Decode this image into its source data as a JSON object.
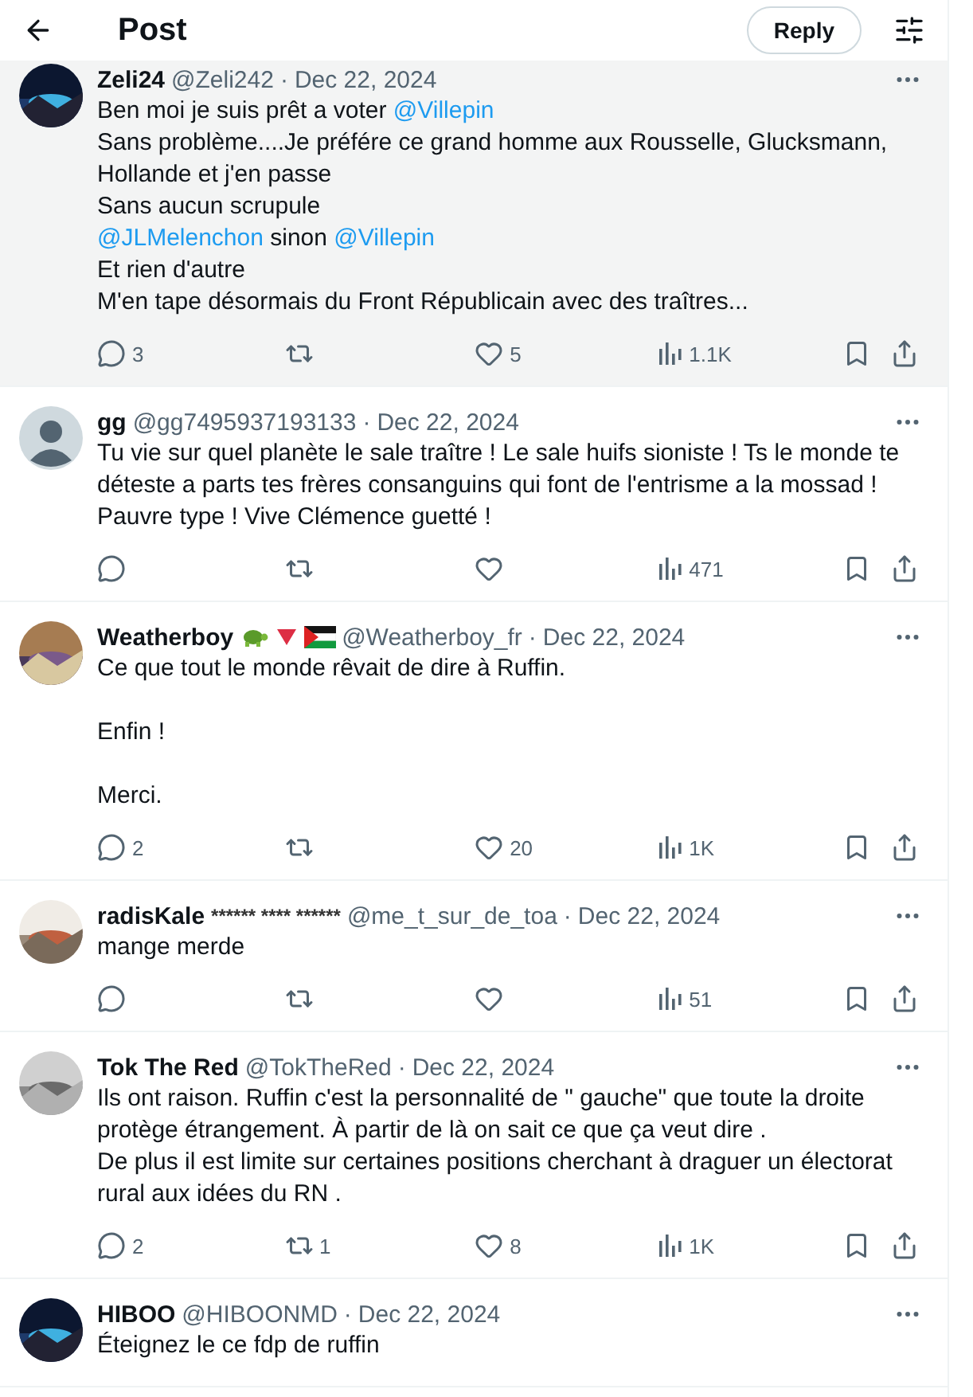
{
  "header": {
    "title": "Post",
    "reply_button": "Reply"
  },
  "replies": [
    {
      "name": "Zeli24",
      "handle": "@Zeli242",
      "date": "Dec 22, 2024",
      "separator": "·",
      "highlighted": true,
      "avatar": {
        "kind": "picture"
      },
      "paragraphs": [
        [
          [
            {
              "kind": "text",
              "text": "Ben moi je suis prêt a voter "
            },
            {
              "kind": "mention",
              "text": "@Villepin"
            }
          ],
          [
            {
              "kind": "text",
              "text": "Sans problème....Je préfére ce grand homme aux Rousselle, Glucksmann, Hollande et j'en passe"
            }
          ],
          [
            {
              "kind": "text",
              "text": "Sans aucun scrupule"
            }
          ],
          [
            {
              "kind": "mention",
              "text": "@JLMelenchon"
            },
            {
              "kind": "text",
              "text": " sinon "
            },
            {
              "kind": "mention",
              "text": "@Villepin"
            }
          ],
          [
            {
              "kind": "text",
              "text": "Et rien d'autre"
            }
          ],
          [
            {
              "kind": "text",
              "text": "M'en tape désormais du Front Républicain avec des traîtres..."
            }
          ]
        ]
      ],
      "stats": {
        "replies": "3",
        "likes": "5",
        "views": "1.1K"
      }
    },
    {
      "name": "gg",
      "handle": "@gg7495937193133",
      "date": "Dec 22, 2024",
      "separator": "·",
      "highlighted": false,
      "avatar": {
        "kind": "default"
      },
      "paragraphs": [
        [
          [
            {
              "kind": "text",
              "text": "Tu vie sur quel planète le sale traître ! Le sale huifs sioniste ! Ts le monde te déteste a parts tes frères consanguins qui font de l'entrisme a la mossad ! Pauvre type ! Vive Clémence guetté !"
            }
          ]
        ]
      ],
      "stats": {
        "views": "471"
      }
    },
    {
      "name": "Weatherboy",
      "handle": "@Weatherboy_fr",
      "date": "Dec 22, 2024",
      "separator": "·",
      "highlighted": false,
      "avatar": {
        "kind": "picture"
      },
      "badges": [
        {
          "kind": "turtle"
        },
        {
          "kind": "triangle"
        },
        {
          "kind": "flag"
        }
      ],
      "paragraphs": [
        [
          [
            {
              "kind": "text",
              "text": "Ce que tout le monde rêvait de dire à Ruffin."
            }
          ]
        ],
        [
          [
            {
              "kind": "text",
              "text": "Enfin !"
            }
          ]
        ],
        [
          [
            {
              "kind": "text",
              "text": "Merci."
            }
          ]
        ]
      ],
      "stats": {
        "replies": "2",
        "likes": "20",
        "views": "1K"
      }
    },
    {
      "name": "radisKale",
      "name_suffix": "****** **** ******",
      "handle": "@me_t_sur_de_toa",
      "date": "Dec 22, 2024",
      "separator": "·",
      "highlighted": false,
      "avatar": {
        "kind": "picture"
      },
      "paragraphs": [
        [
          [
            {
              "kind": "text",
              "text": "mange merde"
            }
          ]
        ]
      ],
      "stats": {
        "views": "51"
      }
    },
    {
      "name": "Tok The Red",
      "handle": "@TokTheRed",
      "date": "Dec 22, 2024",
      "separator": "·",
      "highlighted": false,
      "avatar": {
        "kind": "picture"
      },
      "paragraphs": [
        [
          [
            {
              "kind": "text",
              "text": "Ils ont raison. Ruffin c'est la personnalité de \" gauche\" que toute la droite protège étrangement. À partir de là on sait ce que ça veut dire ."
            }
          ],
          [
            {
              "kind": "text",
              "text": "De plus il est limite sur certaines positions cherchant à draguer un électorat rural aux idées du RN ."
            }
          ]
        ]
      ],
      "stats": {
        "replies": "2",
        "reposts": "1",
        "likes": "8",
        "views": "1K"
      }
    },
    {
      "name": "HIBOO",
      "handle": "@HIBOONMD",
      "date": "Dec 22, 2024",
      "separator": "·",
      "highlighted": false,
      "avatar": {
        "kind": "picture"
      },
      "paragraphs": [
        [
          [
            {
              "kind": "text",
              "text": "Éteignez le ce fdp de ruffin"
            }
          ]
        ]
      ]
    }
  ]
}
